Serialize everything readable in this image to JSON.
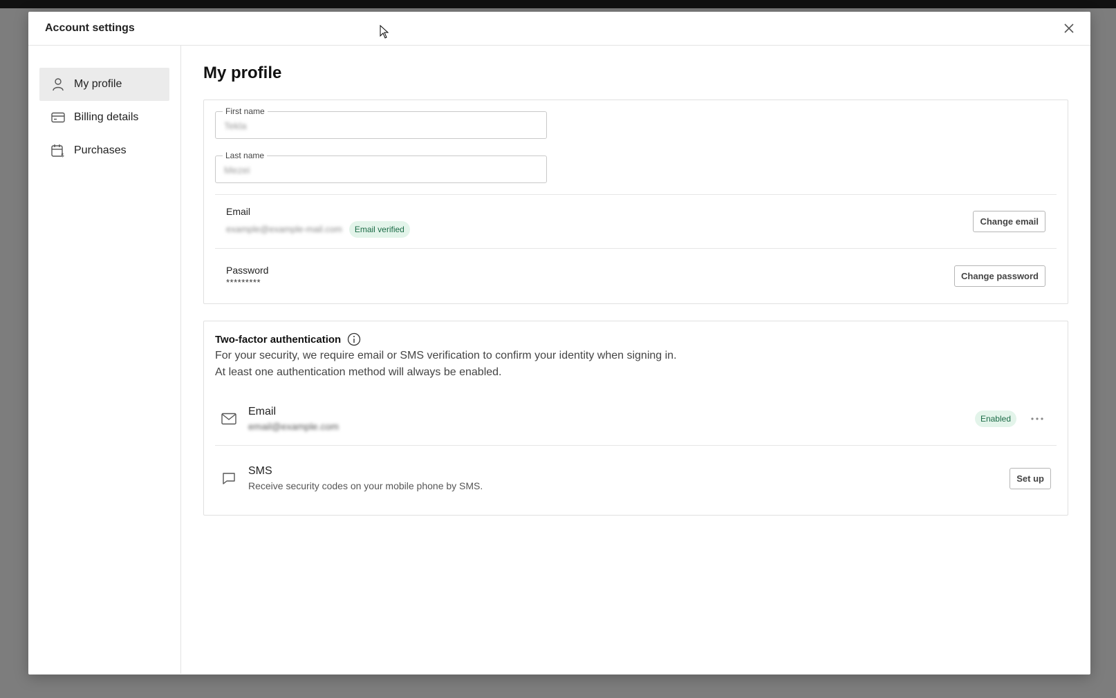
{
  "modal": {
    "title": "Account settings"
  },
  "sidebar": {
    "items": [
      {
        "label": "My profile",
        "icon": "user-icon",
        "active": true
      },
      {
        "label": "Billing details",
        "icon": "credit-card-icon",
        "active": false
      },
      {
        "label": "Purchases",
        "icon": "calendar-dollar-icon",
        "active": false
      }
    ]
  },
  "profile": {
    "title": "My profile",
    "first_name": {
      "label": "First name",
      "value": "Tekla"
    },
    "last_name": {
      "label": "Last name",
      "value": "Mezei"
    },
    "email": {
      "label": "Email",
      "value": "example@example-mail.com",
      "badge": "Email verified",
      "button": "Change email"
    },
    "password": {
      "label": "Password",
      "value": "*********",
      "button": "Change password"
    }
  },
  "tfa": {
    "title": "Two-factor authentication",
    "desc_line1": "For your security, we require email or SMS verification to confirm your identity when signing in.",
    "desc_line2": "At least one authentication method will always be enabled.",
    "email": {
      "name": "Email",
      "value": "email@example.com",
      "status": "Enabled"
    },
    "sms": {
      "name": "SMS",
      "desc": "Receive security codes on your mobile phone by SMS.",
      "button": "Set up"
    }
  },
  "colors": {
    "badge_bg": "#e3f4ea",
    "badge_text": "#1b6b46",
    "active_nav": "#ebebeb"
  }
}
